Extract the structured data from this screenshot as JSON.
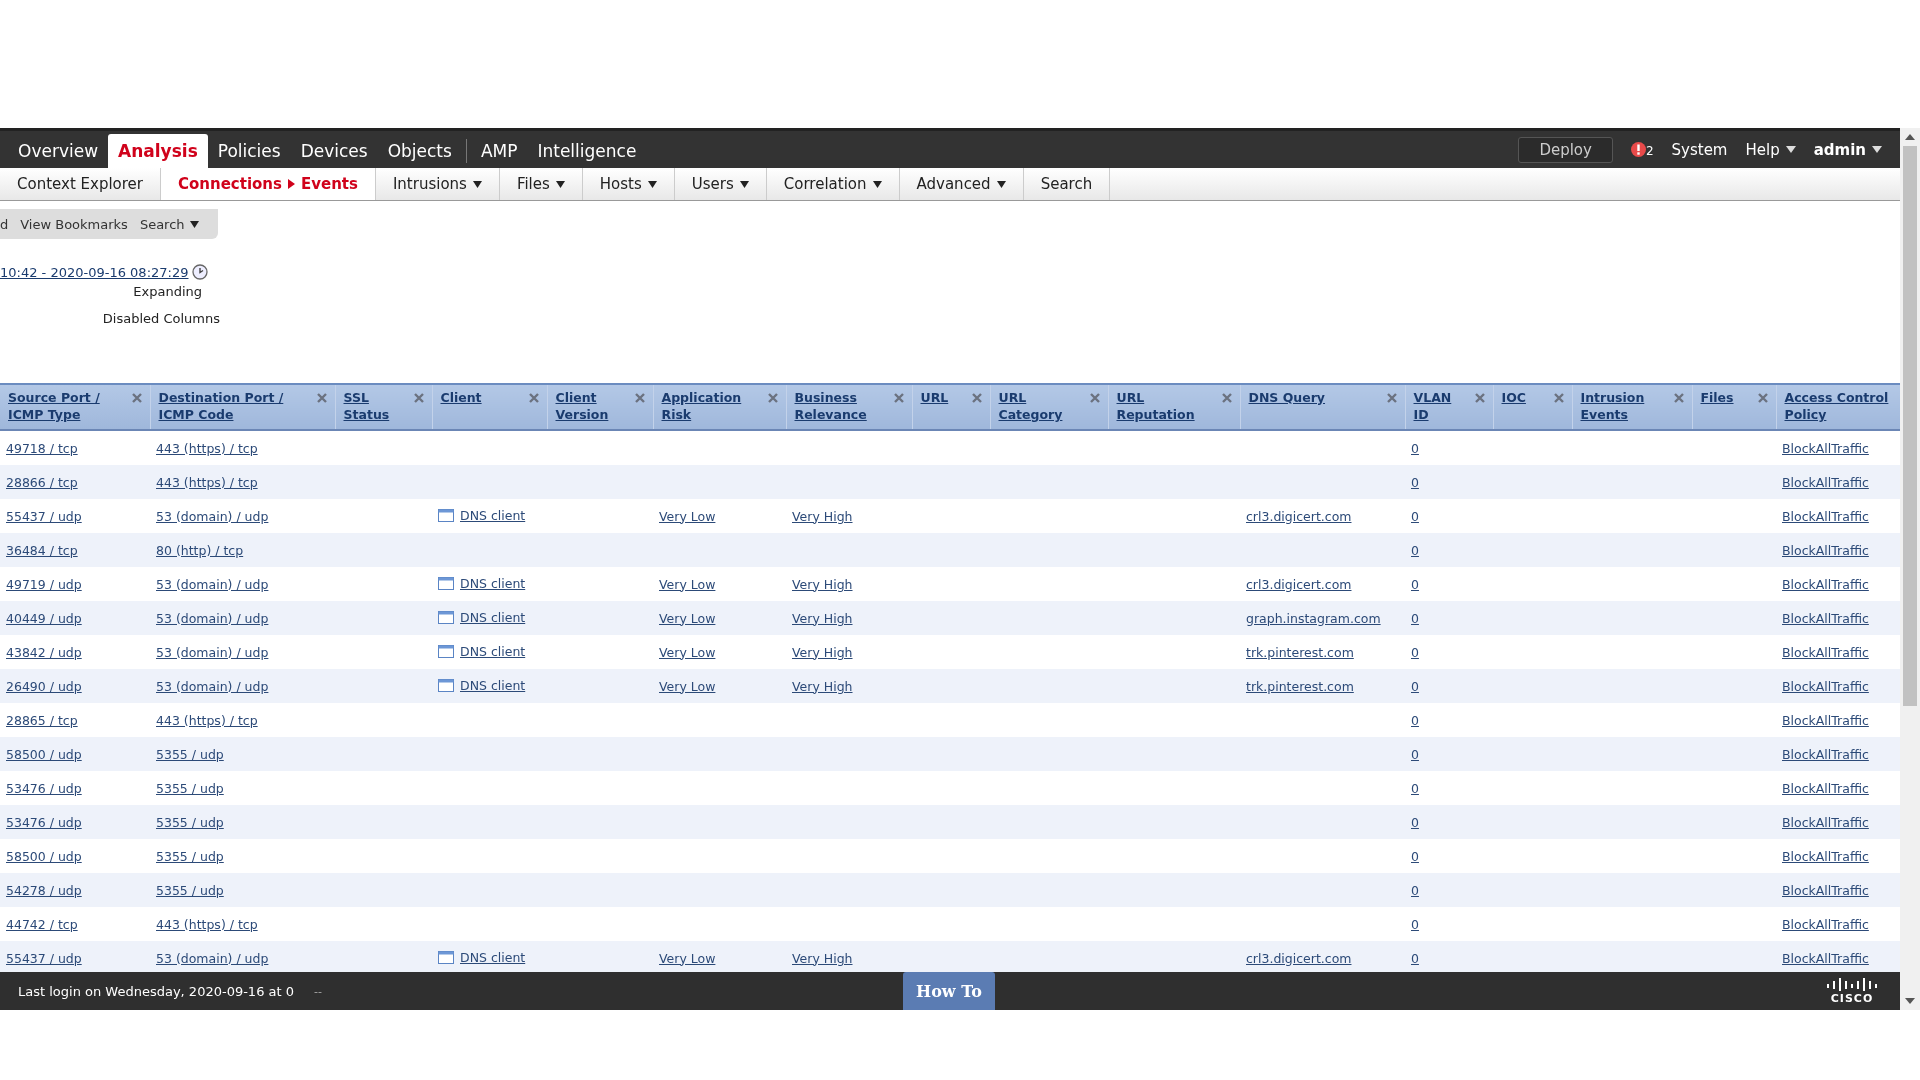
{
  "main_nav": {
    "items": [
      {
        "label": "Overview",
        "selected": false
      },
      {
        "label": "Analysis",
        "selected": true
      },
      {
        "label": "Policies",
        "selected": false
      },
      {
        "label": "Devices",
        "selected": false
      },
      {
        "label": "Objects",
        "selected": false
      }
    ],
    "secondary": [
      {
        "label": "AMP",
        "selected": false
      },
      {
        "label": "Intelligence",
        "selected": false
      }
    ],
    "deploy_button": "Deploy",
    "alert_count": "2",
    "system": "System",
    "help": "Help",
    "user": "admin"
  },
  "sub_nav": [
    {
      "label": "Context Explorer",
      "selected": false,
      "dropdown": false
    },
    {
      "label": "Connections",
      "sublabel": "Events",
      "selected": true,
      "dropdown": false
    },
    {
      "label": "Intrusions",
      "selected": false,
      "dropdown": true
    },
    {
      "label": "Files",
      "selected": false,
      "dropdown": true
    },
    {
      "label": "Hosts",
      "selected": false,
      "dropdown": true
    },
    {
      "label": "Users",
      "selected": false,
      "dropdown": true
    },
    {
      "label": "Correlation",
      "selected": false,
      "dropdown": true
    },
    {
      "label": "Advanced",
      "selected": false,
      "dropdown": true
    },
    {
      "label": "Search",
      "selected": false,
      "dropdown": false
    }
  ],
  "toolbar": {
    "cut_item": "d",
    "view_bookmarks": "View Bookmarks",
    "search": "Search"
  },
  "time_range": "10:42 - 2020-09-16 08:27:29",
  "expanding": "Expanding",
  "disabled_columns": "Disabled Columns",
  "table": {
    "columns": [
      "Source Port /\nICMP Type",
      "Destination Port /\nICMP Code",
      "SSL\nStatus",
      "Client",
      "Client\nVersion",
      "Application\nRisk",
      "Business\nRelevance",
      "URL",
      "URL\nCategory",
      "URL\nReputation",
      "DNS Query",
      "VLAN\nID",
      "IOC",
      "Intrusion\nEvents",
      "Files",
      "Access Control\nPolicy"
    ],
    "rows": [
      {
        "source_port": "49718 / tcp",
        "destination_port": "443 (https) / tcp",
        "vlan_id": "0",
        "access_control_policy": "BlockAllTraffic"
      },
      {
        "source_port": "28866 / tcp",
        "destination_port": "443 (https) / tcp",
        "vlan_id": "0",
        "access_control_policy": "BlockAllTraffic"
      },
      {
        "source_port": "55437 / udp",
        "destination_port": "53 (domain) / udp",
        "client": "DNS client",
        "application_risk": "Very Low",
        "business_relevance": "Very High",
        "dns_query": "crl3.digicert.com",
        "vlan_id": "0",
        "access_control_policy": "BlockAllTraffic"
      },
      {
        "source_port": "36484 / tcp",
        "destination_port": "80 (http) / tcp",
        "vlan_id": "0",
        "access_control_policy": "BlockAllTraffic"
      },
      {
        "source_port": "49719 / udp",
        "destination_port": "53 (domain) / udp",
        "client": "DNS client",
        "application_risk": "Very Low",
        "business_relevance": "Very High",
        "dns_query": "crl3.digicert.com",
        "vlan_id": "0",
        "access_control_policy": "BlockAllTraffic"
      },
      {
        "source_port": "40449 / udp",
        "destination_port": "53 (domain) / udp",
        "client": "DNS client",
        "application_risk": "Very Low",
        "business_relevance": "Very High",
        "dns_query": "graph.instagram.com",
        "vlan_id": "0",
        "access_control_policy": "BlockAllTraffic"
      },
      {
        "source_port": "43842 / udp",
        "destination_port": "53 (domain) / udp",
        "client": "DNS client",
        "application_risk": "Very Low",
        "business_relevance": "Very High",
        "dns_query": "trk.pinterest.com",
        "vlan_id": "0",
        "access_control_policy": "BlockAllTraffic"
      },
      {
        "source_port": "26490 / udp",
        "destination_port": "53 (domain) / udp",
        "client": "DNS client",
        "application_risk": "Very Low",
        "business_relevance": "Very High",
        "dns_query": "trk.pinterest.com",
        "vlan_id": "0",
        "access_control_policy": "BlockAllTraffic"
      },
      {
        "source_port": "28865 / tcp",
        "destination_port": "443 (https) / tcp",
        "vlan_id": "0",
        "access_control_policy": "BlockAllTraffic"
      },
      {
        "source_port": "58500 / udp",
        "destination_port": "5355 / udp",
        "vlan_id": "0",
        "access_control_policy": "BlockAllTraffic"
      },
      {
        "source_port": "53476 / udp",
        "destination_port": "5355 / udp",
        "vlan_id": "0",
        "access_control_policy": "BlockAllTraffic"
      },
      {
        "source_port": "53476 / udp",
        "destination_port": "5355 / udp",
        "vlan_id": "0",
        "access_control_policy": "BlockAllTraffic"
      },
      {
        "source_port": "58500 / udp",
        "destination_port": "5355 / udp",
        "vlan_id": "0",
        "access_control_policy": "BlockAllTraffic"
      },
      {
        "source_port": "54278 / udp",
        "destination_port": "5355 / udp",
        "vlan_id": "0",
        "access_control_policy": "BlockAllTraffic"
      },
      {
        "source_port": "44742 / tcp",
        "destination_port": "443 (https) / tcp",
        "vlan_id": "0",
        "access_control_policy": "BlockAllTraffic"
      },
      {
        "source_port": "55437 / udp",
        "destination_port": "53 (domain) / udp",
        "client": "DNS client",
        "application_risk": "Very Low",
        "business_relevance": "Very High",
        "dns_query": "crl3.digicert.com",
        "vlan_id": "0",
        "access_control_policy": "BlockAllTraffic"
      }
    ]
  },
  "footer": {
    "last_login": "Last login on Wednesday, 2020-09-16 at 0",
    "trailing": "--",
    "how_to": "How To",
    "logo_text": "CISCO"
  }
}
